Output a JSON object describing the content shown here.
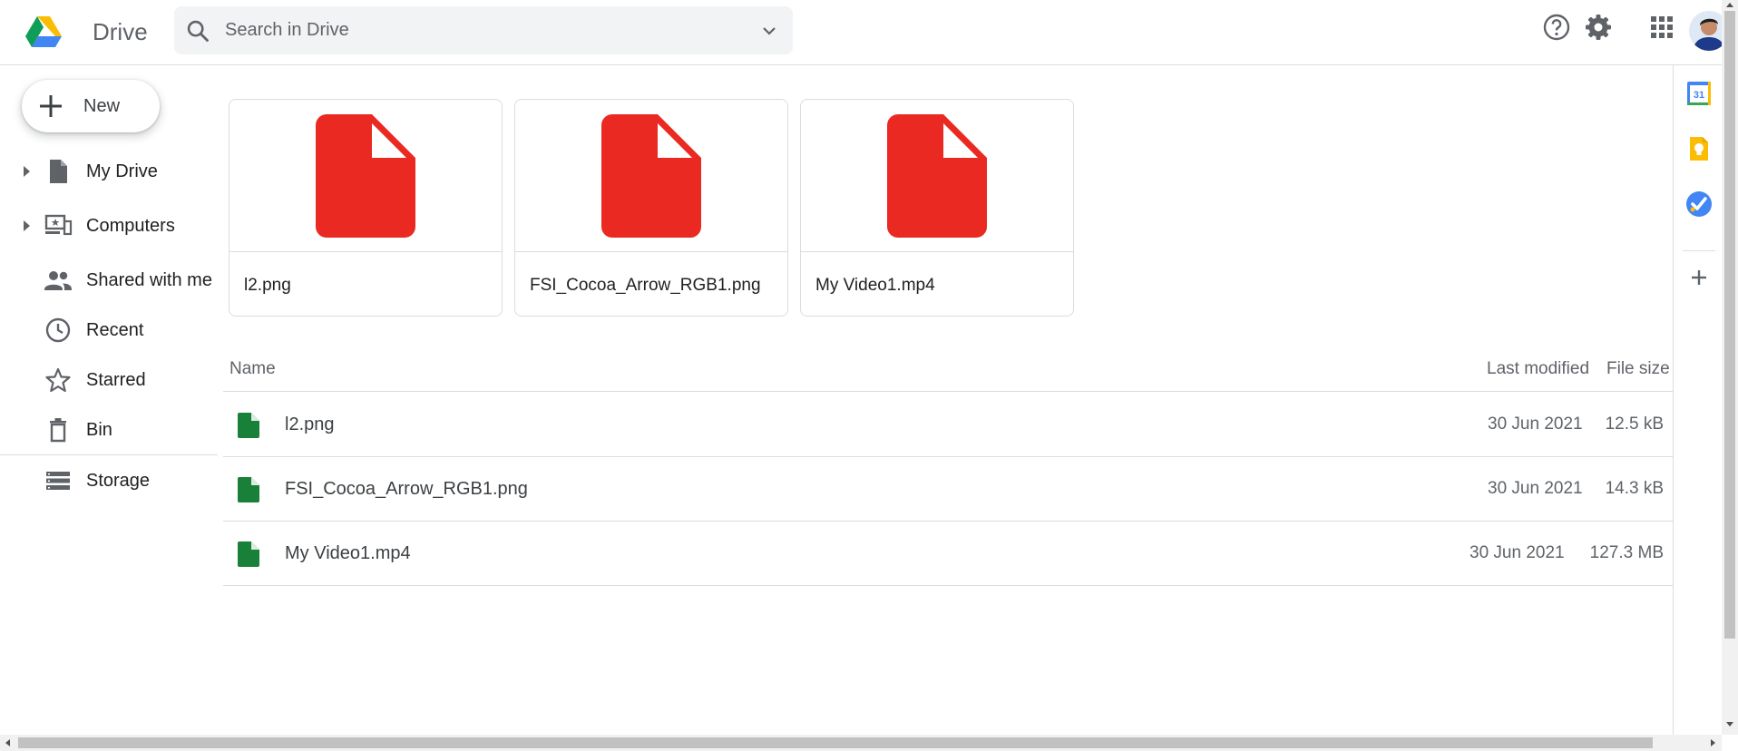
{
  "header": {
    "app_name": "Drive",
    "search": {
      "placeholder": "Search in Drive",
      "value": ""
    }
  },
  "sidebar": {
    "new_label": "New",
    "items": [
      {
        "label": "My Drive",
        "icon": "drive-file-icon",
        "expandable": true
      },
      {
        "label": "Computers",
        "icon": "computer-icon",
        "expandable": true
      },
      {
        "label": "Shared with me",
        "icon": "people-icon",
        "expandable": false
      },
      {
        "label": "Recent",
        "icon": "clock-icon",
        "expandable": false
      },
      {
        "label": "Starred",
        "icon": "star-icon",
        "expandable": false
      },
      {
        "label": "Bin",
        "icon": "trash-icon",
        "expandable": false
      },
      {
        "label": "Storage",
        "icon": "storage-icon",
        "expandable": false
      }
    ]
  },
  "suggested": [
    {
      "name": "l2.png"
    },
    {
      "name": "FSI_Cocoa_Arrow_RGB1.png"
    },
    {
      "name": "My Video1.mp4"
    }
  ],
  "list": {
    "columns": {
      "name": "Name",
      "modified": "Last modified",
      "size": "File size"
    },
    "rows": [
      {
        "name": "l2.png",
        "modified": "30 Jun 2021",
        "size": "12.5 kB"
      },
      {
        "name": "FSI_Cocoa_Arrow_RGB1.png",
        "modified": "30 Jun 2021",
        "size": "14.3 kB"
      },
      {
        "name": "My Video1.mp4",
        "modified": "30 Jun 2021",
        "size": "127.3 MB"
      }
    ]
  },
  "side_panel": {
    "calendar_day": "31"
  },
  "colors": {
    "pdf_red": "#ea2a22",
    "file_green": "#188038",
    "icon_gray": "#5f6368",
    "keep_yellow": "#fbbc04",
    "tasks_blue": "#4285f4"
  }
}
